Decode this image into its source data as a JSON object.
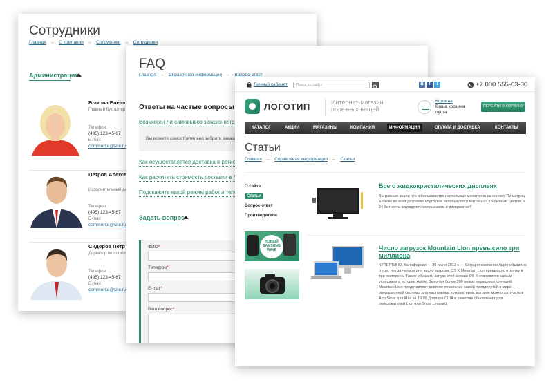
{
  "card1": {
    "title": "Сотрудники",
    "breadcrumb": [
      "Главная",
      "О компании",
      "Сотрудники",
      "Сотрудники"
    ],
    "breadcrumb_sep": "→",
    "section": "Администрация",
    "employees": [
      {
        "name": "Быкова Елена В",
        "role": "Главный бухгалтер",
        "phone_label": "Телефон:",
        "phone": "(495) 123-45-67",
        "email_label": "E-mail:",
        "email": "commerce@site.ru"
      },
      {
        "name": "Петров Алексей Александрович",
        "role": "Исполнительный дире",
        "phone_label": "Телефон:",
        "phone": "(495) 123-45-67",
        "email_label": "E-mail:",
        "email": "commerce@site.ru"
      },
      {
        "name": "Сидоров Петр С",
        "role": "Директор по логистик",
        "phone_label": "Телефон:",
        "phone": "(495) 123-45-67",
        "email_label": "E-mail:",
        "email": "commerce@site.ru"
      }
    ]
  },
  "card2": {
    "title": "FAQ",
    "breadcrumb": [
      "Главная",
      "Справочная информация",
      "Вопрос-ответ"
    ],
    "heading": "Ответы на частые вопросы",
    "questions": [
      "Возможен ли самовывоз заказанного т",
      "Как осуществляется доставка в регион",
      "Как расчитать стоимость доставки в М",
      "Подскажите какой режим работы телеф"
    ],
    "answer": "Вы можете самостоятельно забрать заказанн",
    "ask_section": "Задать вопрос",
    "form": {
      "name_label": "ФИО",
      "phone_label": "Телефон",
      "email_label": "E-mail",
      "question_label": "Ваш вопрос",
      "required": "*"
    }
  },
  "card3": {
    "top": {
      "cabinet": "Личный кабинет",
      "search_placeholder": "Поиск по сайту",
      "social": [
        "B",
        "f",
        "t"
      ],
      "phone": "+7 000 555-03-30"
    },
    "logo": "ЛОГОТИП",
    "slogan": "Интернет-магазин полезных вещей",
    "cart": {
      "title": "Корзина",
      "line1": "Ваша корзина",
      "line2": "пуста",
      "button": "ПЕРЕЙТИ В КОРЗИНУ"
    },
    "nav": [
      "КАТАЛОГ",
      "АКЦИИ",
      "МАГАЗИНЫ",
      "КОМПАНИЯ",
      "ИНФОРМАЦИЯ",
      "ОПЛАТА И ДОСТАВКА",
      "КОНТАКТЫ"
    ],
    "nav_active": "ИНФОРМАЦИЯ",
    "title": "Статьи",
    "breadcrumb": [
      "Главная",
      "Справочная информация",
      "Статьи"
    ],
    "sidebar": [
      "О сайте",
      "Статьи",
      "Вопрос-ответ",
      "Производители"
    ],
    "banner1": [
      "НОВЫЙ",
      "SAMSUNG",
      "WAVE"
    ],
    "articles": [
      {
        "title": "Все о жидкокристалических дисплеях",
        "text": "Вы равные знали что в большинстве настольных мониторов на основе TN матриц, а также во всех дисплеях ноутбуков используются матрицы с 18-битным цветом, а 24-битность эмулируется мерцанием с дизерингом?"
      },
      {
        "title": "Число загрузок Mountain Lion превысило три миллиона",
        "text": "КУПЕРТИНО, Калифорния — 30 июля 2012 г. — Сегодня компания Apple объявила о том, что за четыре дня число загрузок OS X Mountain Lion превысило отметку в три миллиона. Таким образом, запуск этой версии OS X становится самым успешным в истории Apple. Включая более 200 новых передовых функций, Mountain Lion представляет девятое поколение самой продвинутой в мире операционной системы для настольных компьютеров, которое можно загрузить в App Store для Mac за 19,99 Доллара США в качестве обновления для пользователей Lion или Snow Leopard."
      }
    ]
  }
}
